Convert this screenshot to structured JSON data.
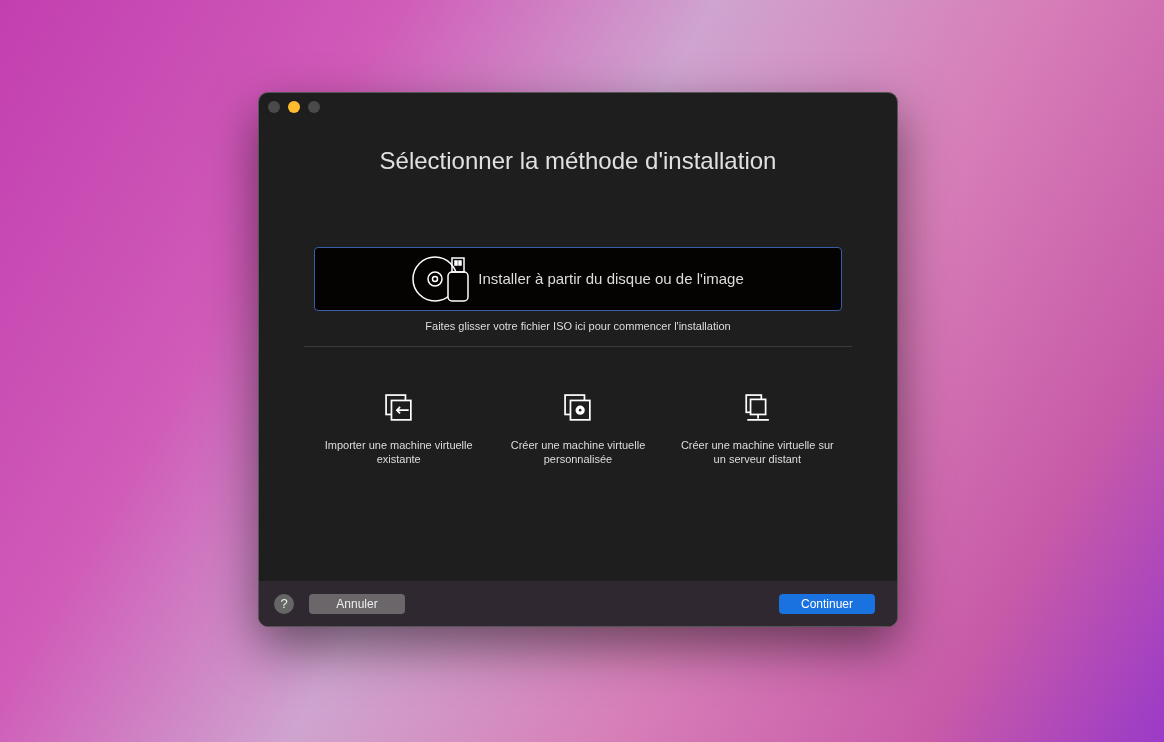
{
  "window": {
    "title": "Sélectionner la méthode d'installation"
  },
  "traffic_lights": [
    {
      "color": "#4a4a4a"
    },
    {
      "color": "#febc2e"
    },
    {
      "color": "#4a4a4a"
    }
  ],
  "main_option": {
    "label": "Installer à partir du disque ou de l'image",
    "selected": true,
    "hint": "Faites glisser votre fichier ISO ici pour commencer l'installation"
  },
  "options": [
    {
      "kind": "import",
      "label": "Importer une machine virtuelle existante"
    },
    {
      "kind": "custom",
      "label": "Créer une machine virtuelle personnalisée"
    },
    {
      "kind": "remote",
      "label": "Créer une machine virtuelle sur un serveur distant"
    }
  ],
  "footer": {
    "help": "?",
    "cancel": "Annuler",
    "continue": "Continuer"
  }
}
